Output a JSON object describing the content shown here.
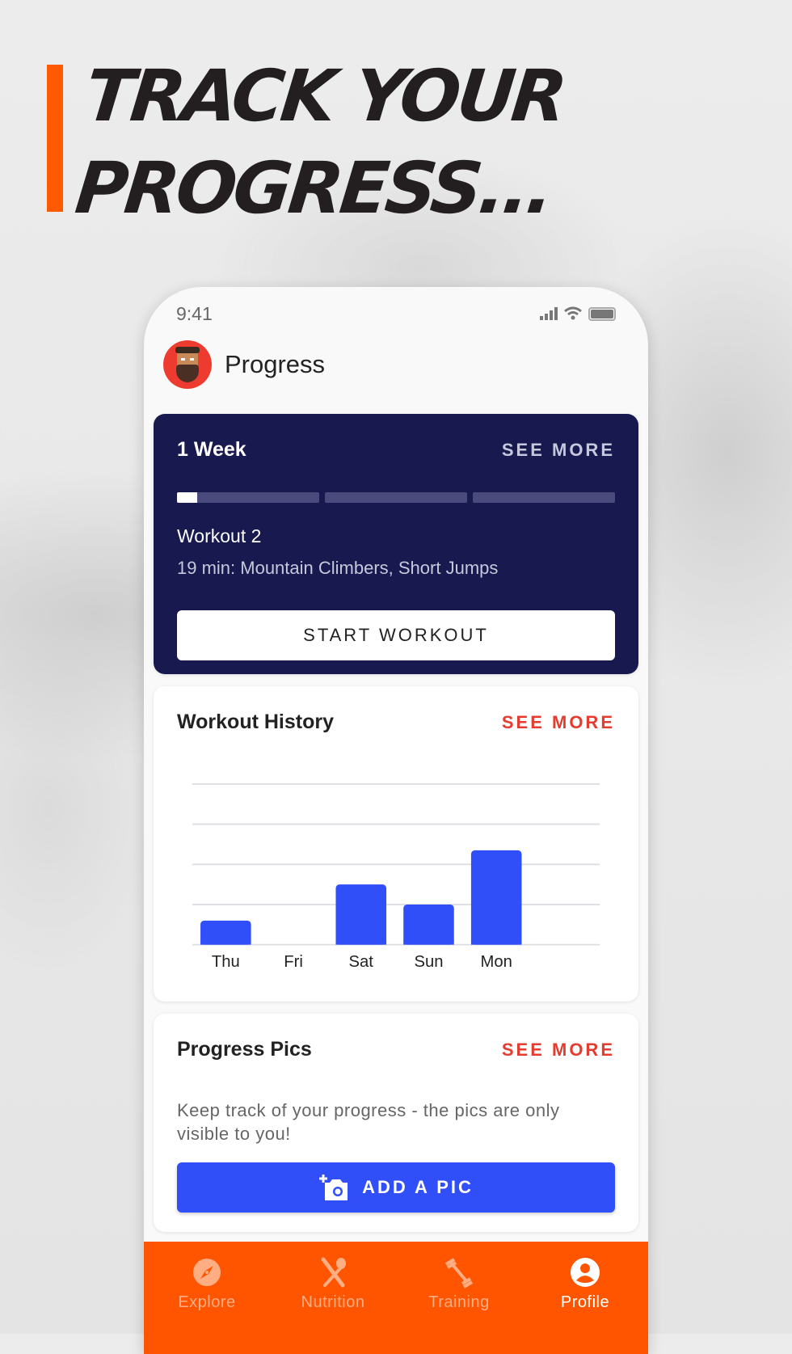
{
  "headline": {
    "line1": "TRACK YOUR",
    "line2": "PROGRESS...",
    "accent_color": "#ff5a00"
  },
  "status_bar": {
    "time": "9:41",
    "icons": [
      "signal-icon",
      "wifi-icon",
      "battery-icon"
    ]
  },
  "header": {
    "title": "Progress",
    "avatar": "avatar"
  },
  "plan_card": {
    "title": "1 Week",
    "see_more": "SEE MORE",
    "progress_segments": [
      0.14,
      0,
      0
    ],
    "workout_name": "Workout 2",
    "workout_desc": "19 min: Mountain Climbers, Short Jumps",
    "button": "START WORKOUT",
    "bg_color": "#18194f"
  },
  "history_card": {
    "title": "Workout History",
    "see_more": "SEE MORE"
  },
  "chart_data": {
    "type": "bar",
    "title": "Workout History",
    "categories": [
      "Thu",
      "Fri",
      "Sat",
      "Sun",
      "Mon"
    ],
    "values": [
      0.6,
      0,
      1.5,
      1.0,
      2.35
    ],
    "xlabel": "",
    "ylabel": "",
    "ylim": [
      0,
      4
    ],
    "grid": true,
    "bar_color": "#314ff9"
  },
  "pics_card": {
    "title": "Progress Pics",
    "see_more": "SEE MORE",
    "description": "Keep track of your progress - the pics are only visible to you!",
    "button": "ADD A PIC"
  },
  "nav": {
    "items": [
      {
        "label": "Explore",
        "icon": "compass-icon",
        "active": false
      },
      {
        "label": "Nutrition",
        "icon": "utensils-icon",
        "active": false
      },
      {
        "label": "Training",
        "icon": "dumbbell-icon",
        "active": false
      },
      {
        "label": "Profile",
        "icon": "profile-icon",
        "active": true
      }
    ],
    "bg_color": "#ff5500"
  }
}
